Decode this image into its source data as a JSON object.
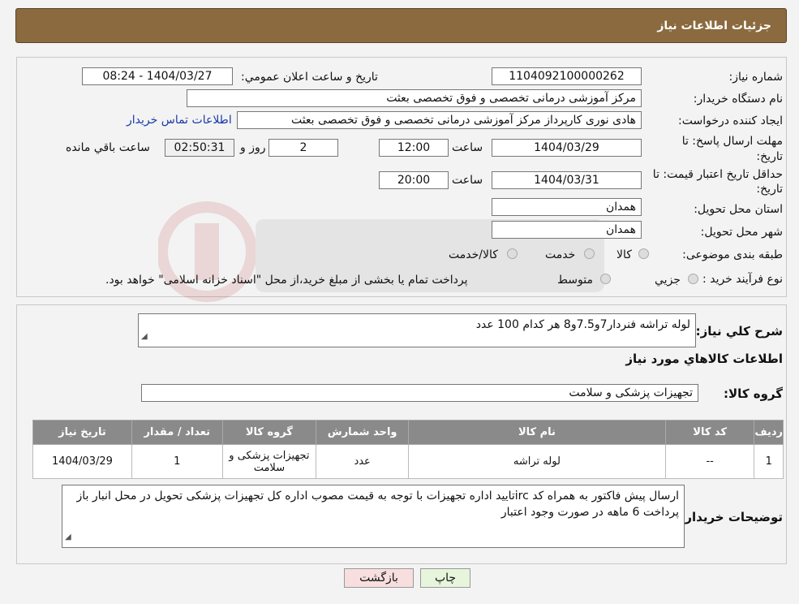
{
  "header": {
    "title": "جزئیات اطلاعات نیاز"
  },
  "fields": {
    "need_number_label": "شماره نیاز:",
    "need_number": "1104092100000262",
    "announce_label": "تاریخ و ساعت اعلان عمومي:",
    "announce_value": "1404/03/27 - 08:24",
    "buyer_org_label": "نام دستگاه خريدار:",
    "buyer_org": "مرکز آموزشی درمانی تخصصی و فوق تخصصی بعثت",
    "creator_label": "ایجاد کننده درخواست:",
    "creator": "هادی نوری کارپرداز مرکز آموزشی درمانی تخصصی و فوق تخصصی بعثت",
    "contact_link": "اطلاعات تماس خریدار",
    "deadline_label_1": "مهلت ارسال پاسخ: تا",
    "deadline_label_2": "تاریخ:",
    "deadline_date": "1404/03/29",
    "time_label": "ساعت",
    "deadline_time": "12:00",
    "days_value": "2",
    "days_label": "روز و",
    "remaining_time": "02:50:31",
    "remaining_label": "ساعت باقي مانده",
    "validity_label_1": "حداقل تاریخ اعتبار قیمت: تا",
    "validity_label_2": "تاریخ:",
    "validity_date": "1404/03/31",
    "validity_time": "20:00",
    "province_label": "استان محل تحویل:",
    "province": "همدان",
    "city_label": "شهر محل تحویل:",
    "city": "همدان",
    "category_label": "طبقه بندی موضوعی:",
    "category_options": [
      "کالا",
      "خدمت",
      "کالا/خدمت"
    ],
    "process_label": "نوع فرآیند خرید :",
    "process_options": [
      "جزيي",
      "متوسط"
    ],
    "process_note": "پرداخت تمام یا بخشی از مبلغ خرید،از محل \"اسناد خزانه اسلامی\" خواهد بود."
  },
  "summary": {
    "label": "شرح کلي نياز:",
    "text": "لوله تراشه فنردار7و7.5و8 هر کدام 100 عدد"
  },
  "goods_info_title": "اطلاعات کالاهاي مورد نياز",
  "goods_group_label": "گروه کالا:",
  "goods_group": "تجهیزات پزشکی و سلامت",
  "table": {
    "headers": [
      "رديف",
      "کد کالا",
      "نام کالا",
      "واحد شمارش",
      "گروه کالا",
      "تعداد / مقدار",
      "تاريخ نياز"
    ],
    "rows": [
      [
        "1",
        "--",
        "لوله تراشه",
        "عدد",
        "تجهیزات پزشکی و سلامت",
        "1",
        "1404/03/29"
      ]
    ]
  },
  "buyer_notes": {
    "label": "توضيحات خريدار:",
    "text": "ارسال پیش فاکتور به همراه کد ircتایید اداره تجهیزات  با توجه به قیمت مصوب اداره کل تجهیزات پزشکی تحویل در محل انبار باز پرداخت 6 ماهه در صورت وجود اعتبار"
  },
  "buttons": {
    "print": "چاپ",
    "back": "بازگشت"
  },
  "colors": {
    "header_bg": "#8b6a3f",
    "table_header_bg": "#8a8a8a",
    "print_bg": "#e6f5dc",
    "back_bg": "#f8dede",
    "link": "#1a3aa8"
  }
}
